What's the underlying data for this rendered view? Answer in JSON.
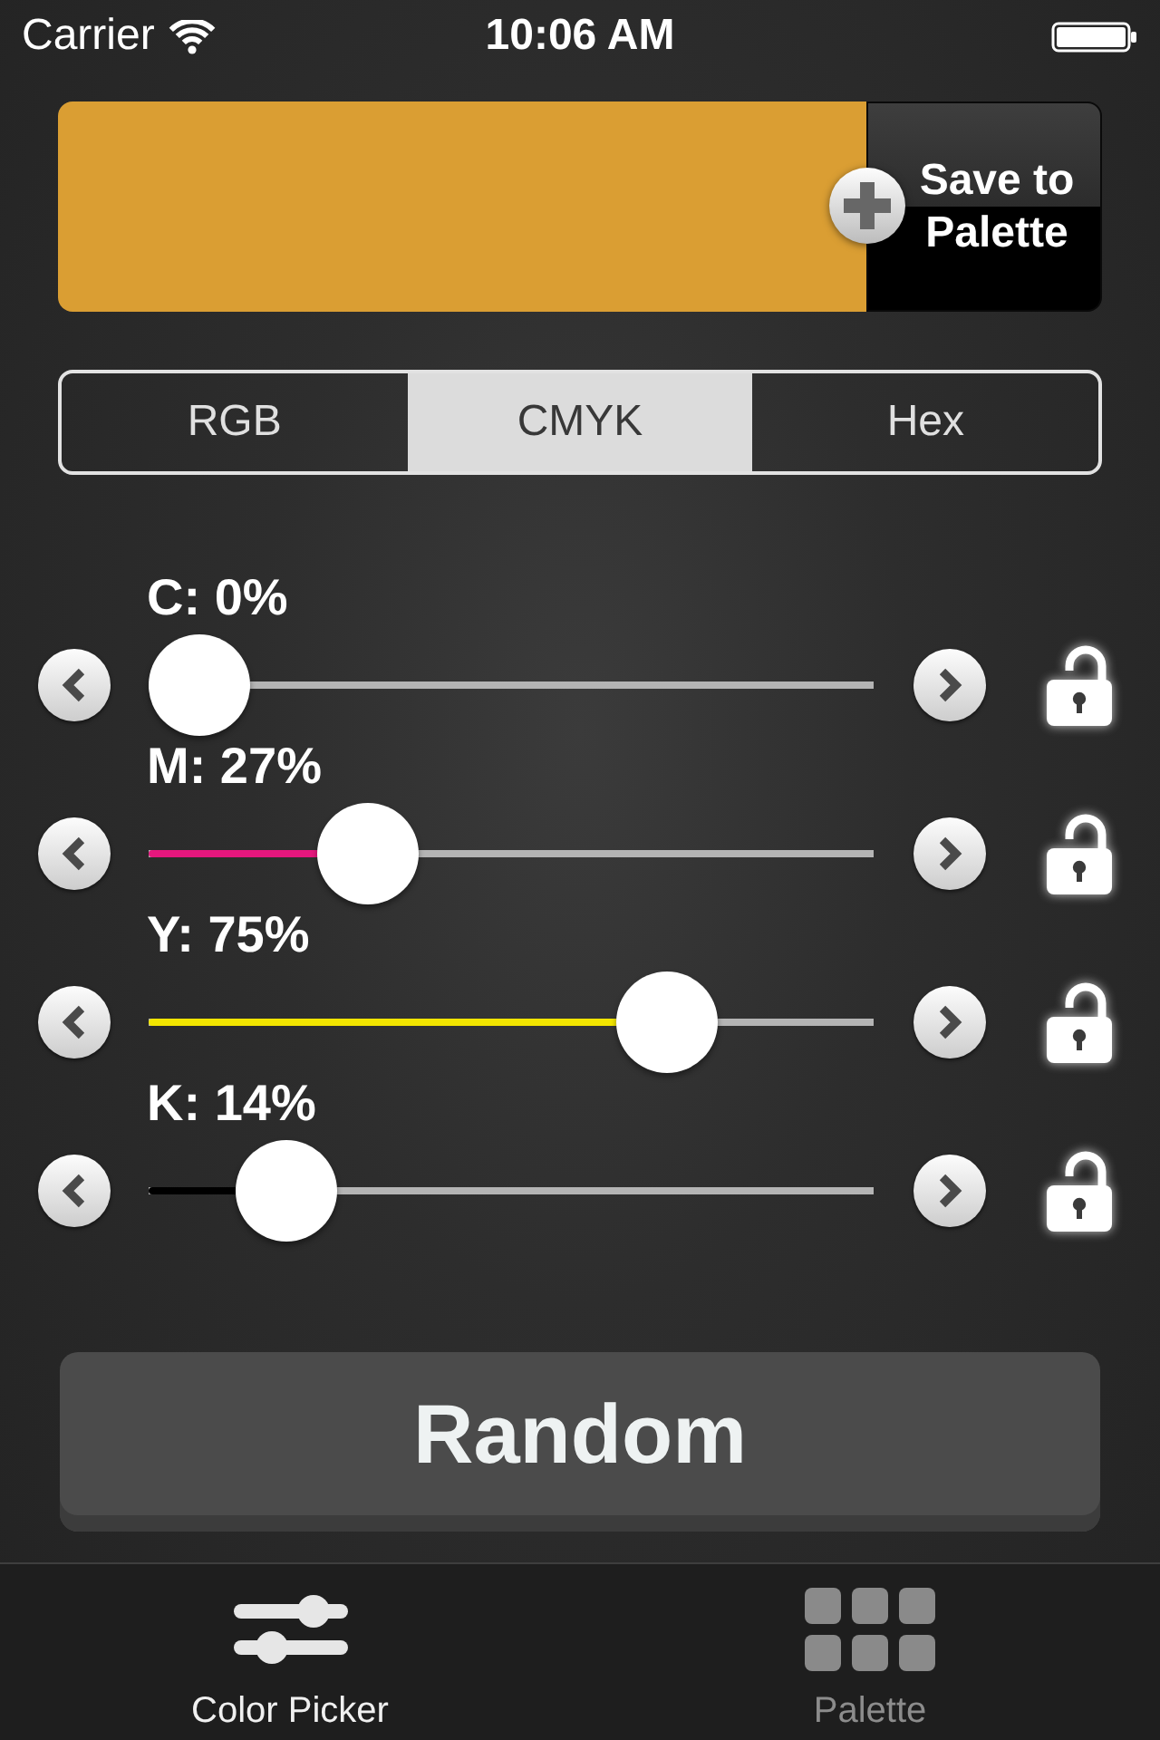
{
  "status_bar": {
    "carrier": "Carrier",
    "time": "10:06 AM"
  },
  "color_preview": {
    "color": "#da9e33",
    "save_button": {
      "label": "Save to Palette"
    }
  },
  "mode_tabs": [
    {
      "label": "RGB",
      "selected": false
    },
    {
      "label": "CMYK",
      "selected": true
    },
    {
      "label": "Hex",
      "selected": false
    }
  ],
  "channels": [
    {
      "label": "C: 0%",
      "level": 0,
      "locked": false
    },
    {
      "label": "M: 27%",
      "level": 0.27,
      "color": "#e5177d",
      "locked": false
    },
    {
      "label": "Y: 75%",
      "level": 0.75,
      "color": "#f2e500",
      "locked": false
    },
    {
      "label": "K: 14%",
      "level": 0.14,
      "color": "#000000",
      "locked": false
    }
  ],
  "random_button": {
    "label": "Random"
  },
  "tab_bar": [
    {
      "label": "Color Picker",
      "kind": "sliders",
      "selected": true
    },
    {
      "label": "Palette",
      "kind": "grid",
      "selected": false
    }
  ]
}
